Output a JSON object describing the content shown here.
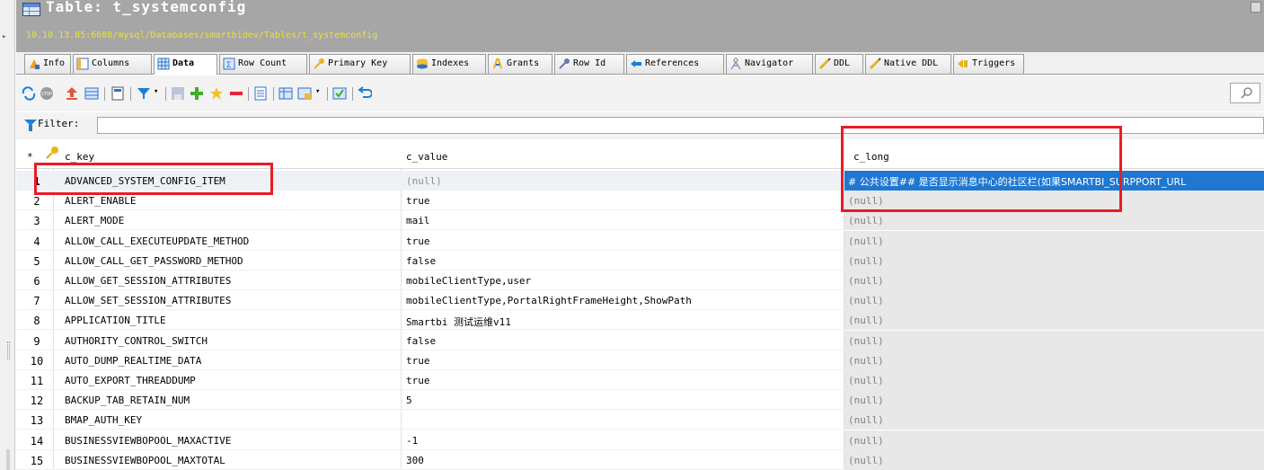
{
  "window": {
    "title": "Table: t_systemconfig",
    "path": "10.10.13.85:6688/mysql/Databases/smartbidev/Tables/t_systemconfig"
  },
  "tabs": [
    {
      "label": "Info",
      "icon": "info-icon",
      "active": false
    },
    {
      "label": "Columns",
      "icon": "columns-icon",
      "active": false
    },
    {
      "label": "Data",
      "icon": "data-grid-icon",
      "active": true
    },
    {
      "label": "Row Count",
      "icon": "row-count-icon",
      "active": false
    },
    {
      "label": "Primary Key",
      "icon": "key-icon",
      "active": false
    },
    {
      "label": "Indexes",
      "icon": "indexes-icon",
      "active": false
    },
    {
      "label": "Grants",
      "icon": "grants-icon",
      "active": false
    },
    {
      "label": "Row Id",
      "icon": "row-id-icon",
      "active": false
    },
    {
      "label": "References",
      "icon": "references-icon",
      "active": false
    },
    {
      "label": "Navigator",
      "icon": "navigator-icon",
      "active": false
    },
    {
      "label": "DDL",
      "icon": "ddl-icon",
      "active": false
    },
    {
      "label": "Native DDL",
      "icon": "native-ddl-icon",
      "active": false
    },
    {
      "label": "Triggers",
      "icon": "triggers-icon",
      "active": false
    }
  ],
  "filter": {
    "label": "Filter:",
    "value": ""
  },
  "grid": {
    "columns": {
      "marker": "*",
      "key": "c_key",
      "value": "c_value",
      "long": "c_long"
    },
    "rows": [
      {
        "num": "1",
        "key": "ADVANCED_SYSTEM_CONFIG_ITEM",
        "value": "(null)",
        "long": "# 公共设置## 是否显示消息中心的社区栏(如果SMARTBI_SURPPORT_URL"
      },
      {
        "num": "2",
        "key": "ALERT_ENABLE",
        "value": "true",
        "long": "(null)"
      },
      {
        "num": "3",
        "key": "ALERT_MODE",
        "value": "mail",
        "long": "(null)"
      },
      {
        "num": "4",
        "key": "ALLOW_CALL_EXECUTEUPDATE_METHOD",
        "value": "true",
        "long": "(null)"
      },
      {
        "num": "5",
        "key": "ALLOW_CALL_GET_PASSWORD_METHOD",
        "value": "false",
        "long": "(null)"
      },
      {
        "num": "6",
        "key": "ALLOW_GET_SESSION_ATTRIBUTES",
        "value": "mobileClientType,user",
        "long": "(null)"
      },
      {
        "num": "7",
        "key": "ALLOW_SET_SESSION_ATTRIBUTES",
        "value": "mobileClientType,PortalRightFrameHeight,ShowPath",
        "long": "(null)"
      },
      {
        "num": "8",
        "key": "APPLICATION_TITLE",
        "value": "Smartbi 测试运维v11",
        "long": "(null)"
      },
      {
        "num": "9",
        "key": "AUTHORITY_CONTROL_SWITCH",
        "value": "false",
        "long": "(null)"
      },
      {
        "num": "10",
        "key": "AUTO_DUMP_REALTIME_DATA",
        "value": "true",
        "long": "(null)"
      },
      {
        "num": "11",
        "key": "AUTO_EXPORT_THREADDUMP",
        "value": "true",
        "long": "(null)"
      },
      {
        "num": "12",
        "key": "BACKUP_TAB_RETAIN_NUM",
        "value": "5",
        "long": "(null)"
      },
      {
        "num": "13",
        "key": "BMAP_AUTH_KEY",
        "value": "",
        "long": "(null)"
      },
      {
        "num": "14",
        "key": "BUSINESSVIEWBOPOOL_MAXACTIVE",
        "value": "-1",
        "long": "(null)"
      },
      {
        "num": "15",
        "key": "BUSINESSVIEWBOPOOL_MAXTOTAL",
        "value": "300",
        "long": "(null)"
      }
    ]
  },
  "colors": {
    "titlebar": "#a6a6a6",
    "path_text": "#e5e536",
    "selection": "#1e78d2",
    "highlight_box": "#ea1c24"
  }
}
